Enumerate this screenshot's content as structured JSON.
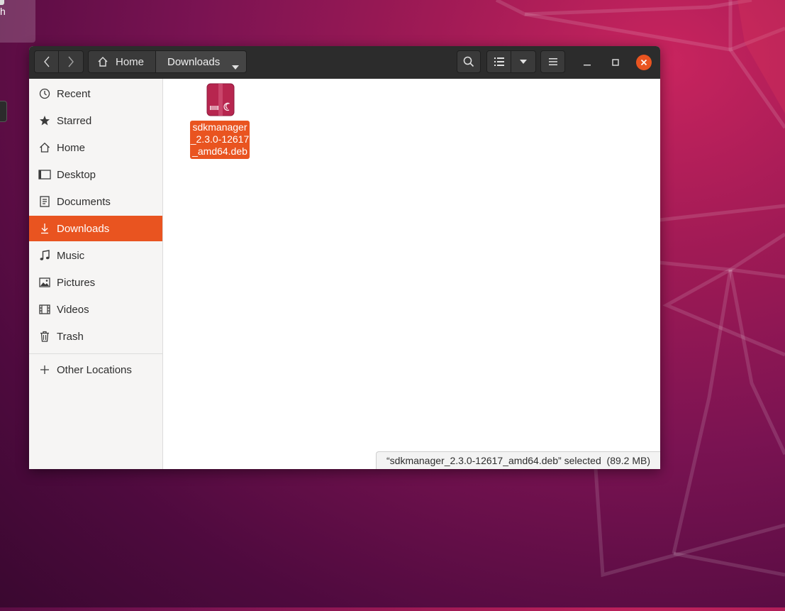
{
  "desktop": {
    "partial_label": "h"
  },
  "window": {
    "pathbar": {
      "home": "Home",
      "current": "Downloads"
    }
  },
  "sidebar": {
    "items": [
      {
        "label": "Recent",
        "icon": "clock-icon"
      },
      {
        "label": "Starred",
        "icon": "star-icon"
      },
      {
        "label": "Home",
        "icon": "home-icon"
      },
      {
        "label": "Desktop",
        "icon": "desktop-icon"
      },
      {
        "label": "Documents",
        "icon": "document-icon"
      },
      {
        "label": "Downloads",
        "icon": "download-icon",
        "active": true
      },
      {
        "label": "Music",
        "icon": "music-note-icon"
      },
      {
        "label": "Pictures",
        "icon": "picture-icon"
      },
      {
        "label": "Videos",
        "icon": "film-icon"
      },
      {
        "label": "Trash",
        "icon": "trash-icon"
      }
    ],
    "other_locations": {
      "label": "Other Locations",
      "icon": "plus-icon"
    }
  },
  "content": {
    "files": [
      {
        "name": "sdkmanager_2.3.0-12617_amd64.deb",
        "display_name": "sdkmanage​r_2.3.0-​12617_​amd64.deb",
        "icon": "deb-package-icon",
        "selected": true
      }
    ],
    "status": "“sdkmanager_2.3.0-12617_amd64.deb” selected  (89.2 MB)"
  },
  "colors": {
    "accent": "#e95420",
    "headerbar": "#2c2c2c",
    "sidebar": "#f6f5f4"
  }
}
